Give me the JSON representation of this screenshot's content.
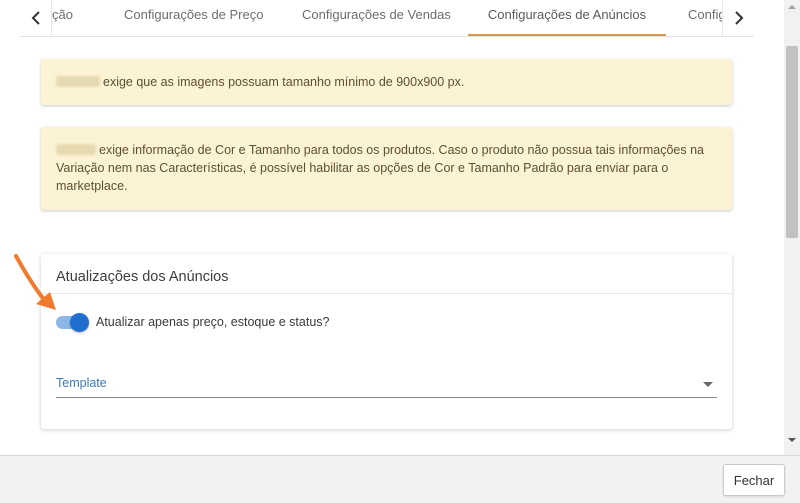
{
  "tabs": [
    {
      "label": "ção"
    },
    {
      "label": "Configurações de Preço"
    },
    {
      "label": "Configurações de Vendas"
    },
    {
      "label": "Configurações de Anúncios",
      "active": true
    },
    {
      "label": "Config"
    }
  ],
  "alerts": {
    "first": "exige que as imagens possuam tamanho mínimo de 900x900 px.",
    "second": "exige informação de Cor e Tamanho para todos os produtos. Caso o produto não possua tais informações na Variação nem nas Características, é possível habilitar as opções de Cor e Tamanho Padrão para enviar para o marketplace."
  },
  "card": {
    "title": "Atualizações dos Anúncios",
    "toggle_label": "Atualizar apenas preço, estoque e status?",
    "toggle_on": true,
    "select_label": "Template"
  },
  "footer": {
    "close_label": "Fechar"
  },
  "colors": {
    "accent_tab": "#d89a4a",
    "alert_bg": "#fcf3d4",
    "toggle_knob": "#1f6ed0",
    "pointer": "#f07b2f"
  },
  "icons": {
    "tab_left": "chevron-left-icon",
    "tab_right": "chevron-right-icon",
    "pointer": "arrow-pointer-icon",
    "select_caret": "caret-down-icon"
  }
}
